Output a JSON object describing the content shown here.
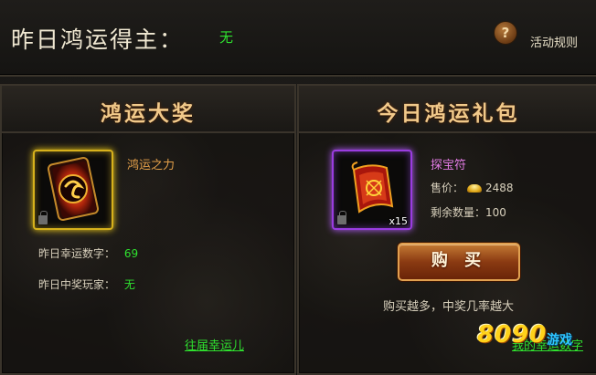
{
  "header": {
    "winner_label": "昨日鸿运得主：",
    "winner_value": "无",
    "help_icon": "question-icon",
    "rules_label": "活动规则"
  },
  "left_panel": {
    "title": "鸿运大奖",
    "item": {
      "name": "鸿运之力",
      "icon": "red-card-icon"
    },
    "lucky_number_label": "昨日幸运数字：",
    "lucky_number_value": "69",
    "winner_player_label": "昨日中奖玩家：",
    "winner_player_value": "无",
    "past_winners_link": "往届幸运儿"
  },
  "right_panel": {
    "title": "今日鸿运礼包",
    "item": {
      "name": "探宝符",
      "icon": "treasure-talisman-icon",
      "quantity": "x15"
    },
    "price_label": "售价：",
    "price_value": "2488",
    "currency_icon": "gold-ingot-icon",
    "remaining_label": "剩余数量：",
    "remaining_value": "100",
    "buy_label": "购 买",
    "buy_tip": "购买越多，中奖几率越大",
    "my_lucky_number_link": "我的幸运数字"
  },
  "watermark": {
    "text": "8090",
    "sub": "游戏"
  },
  "colors": {
    "accent_green": "#2fe22f",
    "title_gold": "#f1c98a",
    "frame_gold": "#d7b11c",
    "frame_purple": "#9a3ce0"
  }
}
